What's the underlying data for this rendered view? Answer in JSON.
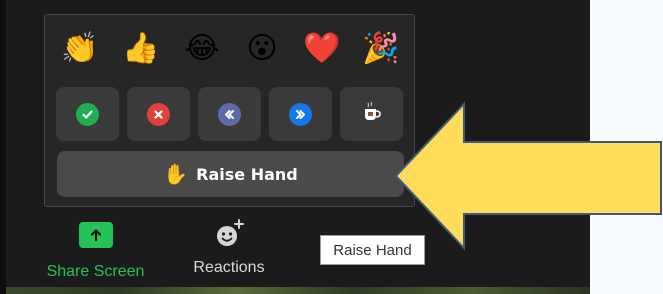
{
  "reactions": {
    "emojis": [
      {
        "name": "clapping-hands",
        "glyph": "👏"
      },
      {
        "name": "thumbs-up",
        "glyph": "👍"
      },
      {
        "name": "tears-of-joy",
        "glyph": "😂"
      },
      {
        "name": "open-mouth",
        "glyph": "😮"
      },
      {
        "name": "red-heart",
        "glyph": "❤️"
      },
      {
        "name": "party-popper",
        "glyph": "🎉"
      }
    ],
    "feedback": [
      {
        "name": "yes",
        "icon": "check-icon",
        "color": "#1fae52"
      },
      {
        "name": "no",
        "icon": "x-icon",
        "color": "#e0413c"
      },
      {
        "name": "slow-down",
        "icon": "double-chevron-left-icon",
        "color": "#5e6aa8"
      },
      {
        "name": "speed-up",
        "icon": "double-chevron-right-icon",
        "color": "#1677e8"
      },
      {
        "name": "coffee",
        "icon": "coffee-cup-icon",
        "color": "#ffffff"
      }
    ],
    "raise_hand": {
      "glyph": "✋",
      "label": "Raise Hand"
    }
  },
  "toolbar": {
    "share_screen_label": "Share Screen",
    "share_screen_color": "#25c25a",
    "reactions_label": "Reactions"
  },
  "tooltip": {
    "text": "Raise Hand"
  },
  "colors": {
    "popup_bg": "#262626",
    "tile_bg": "#3a3a3a",
    "arrow_fill": "#ffdc5a",
    "arrow_stroke": "#3f5a78"
  }
}
